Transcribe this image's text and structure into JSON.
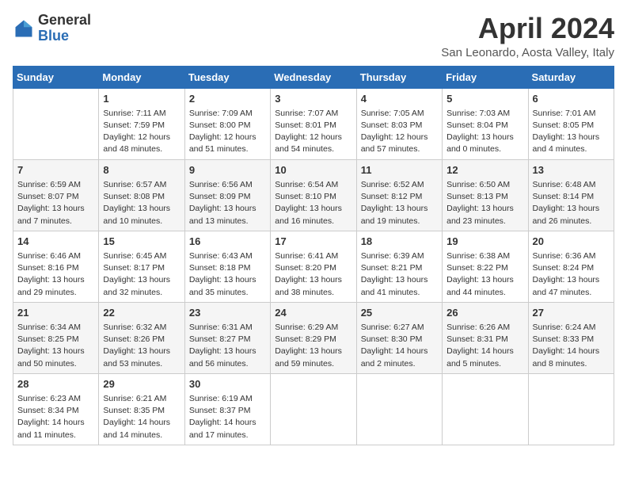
{
  "header": {
    "logo_general": "General",
    "logo_blue": "Blue",
    "month_year": "April 2024",
    "location": "San Leonardo, Aosta Valley, Italy"
  },
  "weekdays": [
    "Sunday",
    "Monday",
    "Tuesday",
    "Wednesday",
    "Thursday",
    "Friday",
    "Saturday"
  ],
  "weeks": [
    [
      {
        "day": "",
        "sunrise": "",
        "sunset": "",
        "daylight": ""
      },
      {
        "day": "1",
        "sunrise": "Sunrise: 7:11 AM",
        "sunset": "Sunset: 7:59 PM",
        "daylight": "Daylight: 12 hours and 48 minutes."
      },
      {
        "day": "2",
        "sunrise": "Sunrise: 7:09 AM",
        "sunset": "Sunset: 8:00 PM",
        "daylight": "Daylight: 12 hours and 51 minutes."
      },
      {
        "day": "3",
        "sunrise": "Sunrise: 7:07 AM",
        "sunset": "Sunset: 8:01 PM",
        "daylight": "Daylight: 12 hours and 54 minutes."
      },
      {
        "day": "4",
        "sunrise": "Sunrise: 7:05 AM",
        "sunset": "Sunset: 8:03 PM",
        "daylight": "Daylight: 12 hours and 57 minutes."
      },
      {
        "day": "5",
        "sunrise": "Sunrise: 7:03 AM",
        "sunset": "Sunset: 8:04 PM",
        "daylight": "Daylight: 13 hours and 0 minutes."
      },
      {
        "day": "6",
        "sunrise": "Sunrise: 7:01 AM",
        "sunset": "Sunset: 8:05 PM",
        "daylight": "Daylight: 13 hours and 4 minutes."
      }
    ],
    [
      {
        "day": "7",
        "sunrise": "Sunrise: 6:59 AM",
        "sunset": "Sunset: 8:07 PM",
        "daylight": "Daylight: 13 hours and 7 minutes."
      },
      {
        "day": "8",
        "sunrise": "Sunrise: 6:57 AM",
        "sunset": "Sunset: 8:08 PM",
        "daylight": "Daylight: 13 hours and 10 minutes."
      },
      {
        "day": "9",
        "sunrise": "Sunrise: 6:56 AM",
        "sunset": "Sunset: 8:09 PM",
        "daylight": "Daylight: 13 hours and 13 minutes."
      },
      {
        "day": "10",
        "sunrise": "Sunrise: 6:54 AM",
        "sunset": "Sunset: 8:10 PM",
        "daylight": "Daylight: 13 hours and 16 minutes."
      },
      {
        "day": "11",
        "sunrise": "Sunrise: 6:52 AM",
        "sunset": "Sunset: 8:12 PM",
        "daylight": "Daylight: 13 hours and 19 minutes."
      },
      {
        "day": "12",
        "sunrise": "Sunrise: 6:50 AM",
        "sunset": "Sunset: 8:13 PM",
        "daylight": "Daylight: 13 hours and 23 minutes."
      },
      {
        "day": "13",
        "sunrise": "Sunrise: 6:48 AM",
        "sunset": "Sunset: 8:14 PM",
        "daylight": "Daylight: 13 hours and 26 minutes."
      }
    ],
    [
      {
        "day": "14",
        "sunrise": "Sunrise: 6:46 AM",
        "sunset": "Sunset: 8:16 PM",
        "daylight": "Daylight: 13 hours and 29 minutes."
      },
      {
        "day": "15",
        "sunrise": "Sunrise: 6:45 AM",
        "sunset": "Sunset: 8:17 PM",
        "daylight": "Daylight: 13 hours and 32 minutes."
      },
      {
        "day": "16",
        "sunrise": "Sunrise: 6:43 AM",
        "sunset": "Sunset: 8:18 PM",
        "daylight": "Daylight: 13 hours and 35 minutes."
      },
      {
        "day": "17",
        "sunrise": "Sunrise: 6:41 AM",
        "sunset": "Sunset: 8:20 PM",
        "daylight": "Daylight: 13 hours and 38 minutes."
      },
      {
        "day": "18",
        "sunrise": "Sunrise: 6:39 AM",
        "sunset": "Sunset: 8:21 PM",
        "daylight": "Daylight: 13 hours and 41 minutes."
      },
      {
        "day": "19",
        "sunrise": "Sunrise: 6:38 AM",
        "sunset": "Sunset: 8:22 PM",
        "daylight": "Daylight: 13 hours and 44 minutes."
      },
      {
        "day": "20",
        "sunrise": "Sunrise: 6:36 AM",
        "sunset": "Sunset: 8:24 PM",
        "daylight": "Daylight: 13 hours and 47 minutes."
      }
    ],
    [
      {
        "day": "21",
        "sunrise": "Sunrise: 6:34 AM",
        "sunset": "Sunset: 8:25 PM",
        "daylight": "Daylight: 13 hours and 50 minutes."
      },
      {
        "day": "22",
        "sunrise": "Sunrise: 6:32 AM",
        "sunset": "Sunset: 8:26 PM",
        "daylight": "Daylight: 13 hours and 53 minutes."
      },
      {
        "day": "23",
        "sunrise": "Sunrise: 6:31 AM",
        "sunset": "Sunset: 8:27 PM",
        "daylight": "Daylight: 13 hours and 56 minutes."
      },
      {
        "day": "24",
        "sunrise": "Sunrise: 6:29 AM",
        "sunset": "Sunset: 8:29 PM",
        "daylight": "Daylight: 13 hours and 59 minutes."
      },
      {
        "day": "25",
        "sunrise": "Sunrise: 6:27 AM",
        "sunset": "Sunset: 8:30 PM",
        "daylight": "Daylight: 14 hours and 2 minutes."
      },
      {
        "day": "26",
        "sunrise": "Sunrise: 6:26 AM",
        "sunset": "Sunset: 8:31 PM",
        "daylight": "Daylight: 14 hours and 5 minutes."
      },
      {
        "day": "27",
        "sunrise": "Sunrise: 6:24 AM",
        "sunset": "Sunset: 8:33 PM",
        "daylight": "Daylight: 14 hours and 8 minutes."
      }
    ],
    [
      {
        "day": "28",
        "sunrise": "Sunrise: 6:23 AM",
        "sunset": "Sunset: 8:34 PM",
        "daylight": "Daylight: 14 hours and 11 minutes."
      },
      {
        "day": "29",
        "sunrise": "Sunrise: 6:21 AM",
        "sunset": "Sunset: 8:35 PM",
        "daylight": "Daylight: 14 hours and 14 minutes."
      },
      {
        "day": "30",
        "sunrise": "Sunrise: 6:19 AM",
        "sunset": "Sunset: 8:37 PM",
        "daylight": "Daylight: 14 hours and 17 minutes."
      },
      {
        "day": "",
        "sunrise": "",
        "sunset": "",
        "daylight": ""
      },
      {
        "day": "",
        "sunrise": "",
        "sunset": "",
        "daylight": ""
      },
      {
        "day": "",
        "sunrise": "",
        "sunset": "",
        "daylight": ""
      },
      {
        "day": "",
        "sunrise": "",
        "sunset": "",
        "daylight": ""
      }
    ]
  ]
}
